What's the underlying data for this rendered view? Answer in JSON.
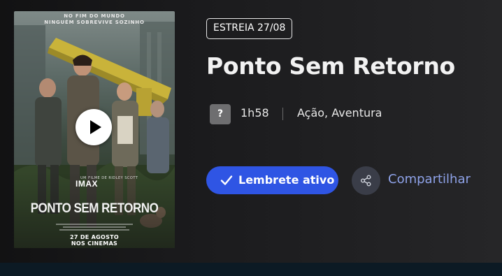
{
  "poster": {
    "tagline_line1": "NO FIM DO MUNDO",
    "tagline_line2": "NINGUÉM SOBREVIVE SOZINHO",
    "director_credit": "UM FILME DE RIDLEY SCOTT",
    "format": "IMAX",
    "title": "PONTO SEM RETORNO",
    "date_line1": "27 DE AGOSTO",
    "date_line2": "NOS CINEMAS"
  },
  "release_badge": "ESTREIA 27/08",
  "title": "Ponto Sem Retorno",
  "meta": {
    "rating": "?",
    "duration": "1h58",
    "genres": "Ação, Aventura"
  },
  "actions": {
    "reminder_label": "Lembrete ativo",
    "share_label": "Compartilhar"
  },
  "icons": {
    "play": "play-icon",
    "check": "check-icon",
    "share": "share-icon"
  },
  "colors": {
    "accent": "#2f55e4",
    "share_text": "#8ea2e8",
    "background": "#1f1f21",
    "bottom_bar": "#0c1a24"
  }
}
